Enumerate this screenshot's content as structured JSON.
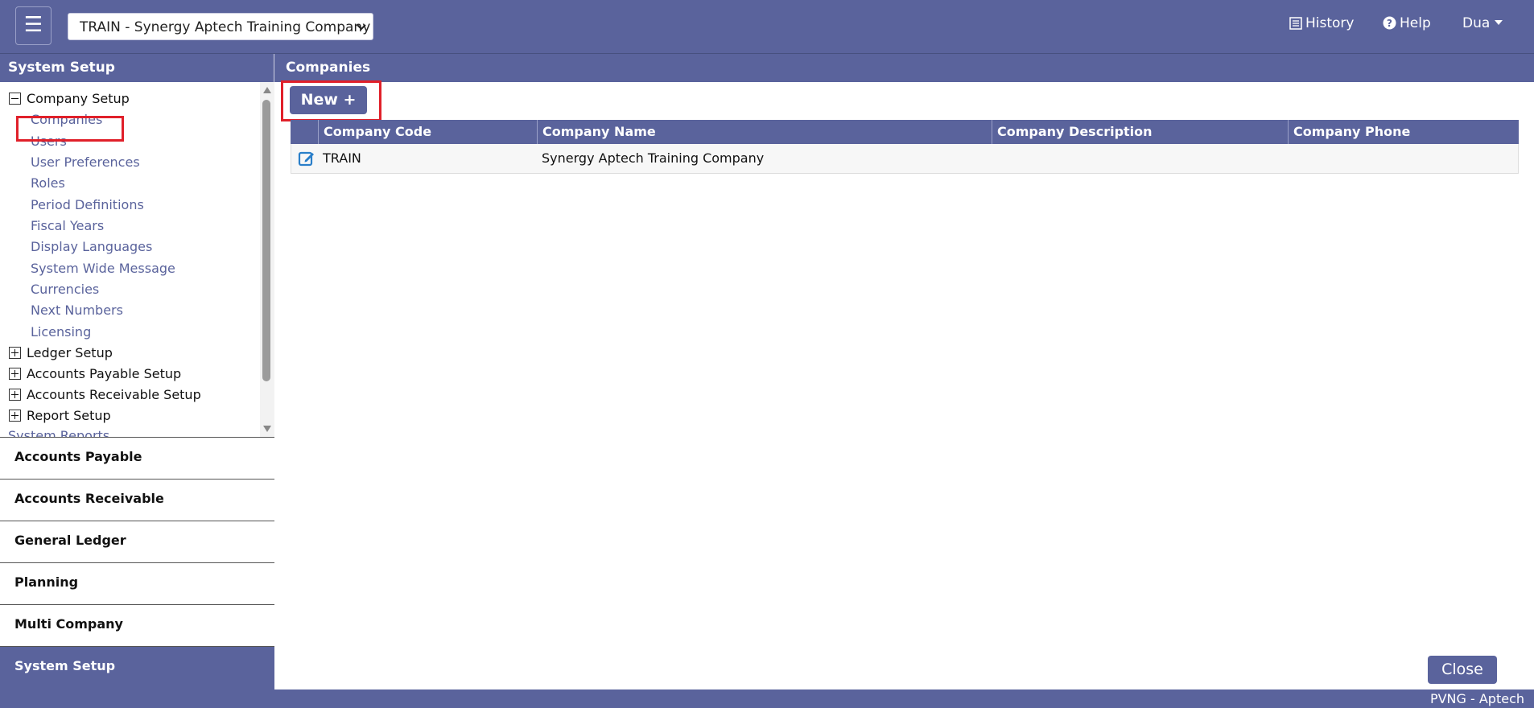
{
  "header": {
    "menu_glyph": "☰",
    "company_select": {
      "value": "TRAIN - Synergy Aptech Training Company"
    },
    "history_label": "History",
    "help_label": "Help",
    "user_label": "Dua"
  },
  "sidebar": {
    "title": "System Setup",
    "tree": [
      {
        "label": "Company Setup",
        "expanded": true,
        "children": [
          "Companies",
          "Users",
          "User Preferences",
          "Roles",
          "Period Definitions",
          "Fiscal Years",
          "Display Languages",
          "System Wide Message",
          "Currencies",
          "Next Numbers",
          "Licensing"
        ]
      },
      {
        "label": "Ledger Setup",
        "expanded": false
      },
      {
        "label": "Accounts Payable Setup",
        "expanded": false
      },
      {
        "label": "Accounts Receivable Setup",
        "expanded": false
      },
      {
        "label": "Report Setup",
        "expanded": false
      }
    ],
    "reports_label": "System Reports",
    "selected_item": "Companies",
    "modules": [
      "Accounts Payable",
      "Accounts Receivable",
      "General Ledger",
      "Planning",
      "Multi Company",
      "System Setup"
    ],
    "active_module": "System Setup"
  },
  "main": {
    "title": "Companies",
    "new_button": "New +",
    "columns": [
      "Company Code",
      "Company Name",
      "Company Description",
      "Company Phone"
    ],
    "rows": [
      {
        "code": "TRAIN",
        "name": "Synergy Aptech Training Company",
        "description": "",
        "phone": ""
      }
    ],
    "close_button": "Close"
  },
  "footer": {
    "text": "PVNG - Aptech"
  },
  "colors": {
    "brand": "#5a639c",
    "highlight": "#e0202a",
    "link": "#5a639c"
  }
}
